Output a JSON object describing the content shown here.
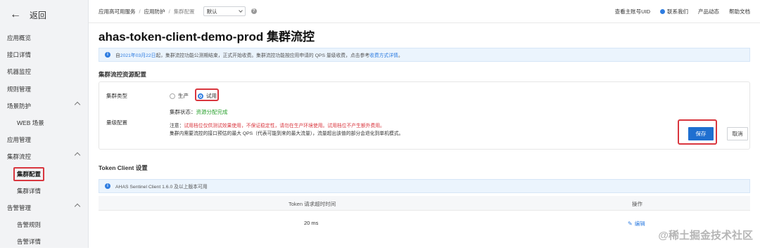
{
  "sidebar": {
    "back_label": "返回",
    "items": [
      {
        "label": "应用概览",
        "sub": false,
        "expand": false,
        "active": false
      },
      {
        "label": "接口详情",
        "sub": false,
        "expand": false,
        "active": false
      },
      {
        "label": "机器监控",
        "sub": false,
        "expand": false,
        "active": false
      },
      {
        "label": "规则管理",
        "sub": false,
        "expand": false,
        "active": false
      },
      {
        "label": "场景防护",
        "sub": false,
        "expand": true,
        "active": false
      },
      {
        "label": "WEB 场景",
        "sub": true,
        "expand": false,
        "active": false
      },
      {
        "label": "应用管理",
        "sub": false,
        "expand": false,
        "active": false
      },
      {
        "label": "集群流控",
        "sub": false,
        "expand": true,
        "active": false
      },
      {
        "label": "集群配置",
        "sub": true,
        "expand": false,
        "active": true
      },
      {
        "label": "集群详情",
        "sub": true,
        "expand": false,
        "active": false
      },
      {
        "label": "告警管理",
        "sub": false,
        "expand": true,
        "active": false
      },
      {
        "label": "告警规则",
        "sub": true,
        "expand": false,
        "active": false
      },
      {
        "label": "告警详情",
        "sub": true,
        "expand": false,
        "active": false
      }
    ]
  },
  "breadcrumb": {
    "items": [
      "应用高可用服务",
      "应用防护",
      "集群配置"
    ],
    "env_value": "默认"
  },
  "topright": {
    "uid": "查看主账号UID",
    "contact": "联系我们",
    "news": "产品动态",
    "docs": "帮助文档"
  },
  "page_title": "ahas-token-client-demo-prod 集群流控",
  "notice": {
    "prefix": "自 ",
    "date": "2021年03月22日",
    "body": " 起，集群流控功能公测期结束，正式开始收费。集群流控功能按应用申请的 QPS 量级收费，点击参考 ",
    "link": "收费方式详情",
    "suffix": "。"
  },
  "resource_section": {
    "title": "集群流控资源配置",
    "cluster_type_label": "集群类型",
    "options": [
      "生产",
      "试用"
    ],
    "selected": "试用",
    "status_label": "集群状态：",
    "status_value": "资源分配完成",
    "level_label": "量级配置",
    "note_prefix": "注意：",
    "note_red": "试用档位仅供测试效果使用，不保证稳定性，请勿在生产环境使用。试用档位不产生额外费用。",
    "note_line2": "集群内需要流控的接口预估的最大 QPS（代表可能到来的最大流量），流量超出该值的部分会退化到单机模式。",
    "save": "保存",
    "cancel": "取消"
  },
  "token_section": {
    "title": "Token Client 设置",
    "notice": "AHAS Sentinel Client 1.6.0 及以上版本可用",
    "columns": [
      "Token 请求超时时间",
      "操作"
    ],
    "row": {
      "timeout": "20 ms",
      "action": "编辑"
    }
  },
  "watermark": "@稀土掘金技术社区",
  "colors": {
    "accent": "#1f6fd0",
    "highlight": "#d9363e",
    "success": "#2aa12e"
  }
}
